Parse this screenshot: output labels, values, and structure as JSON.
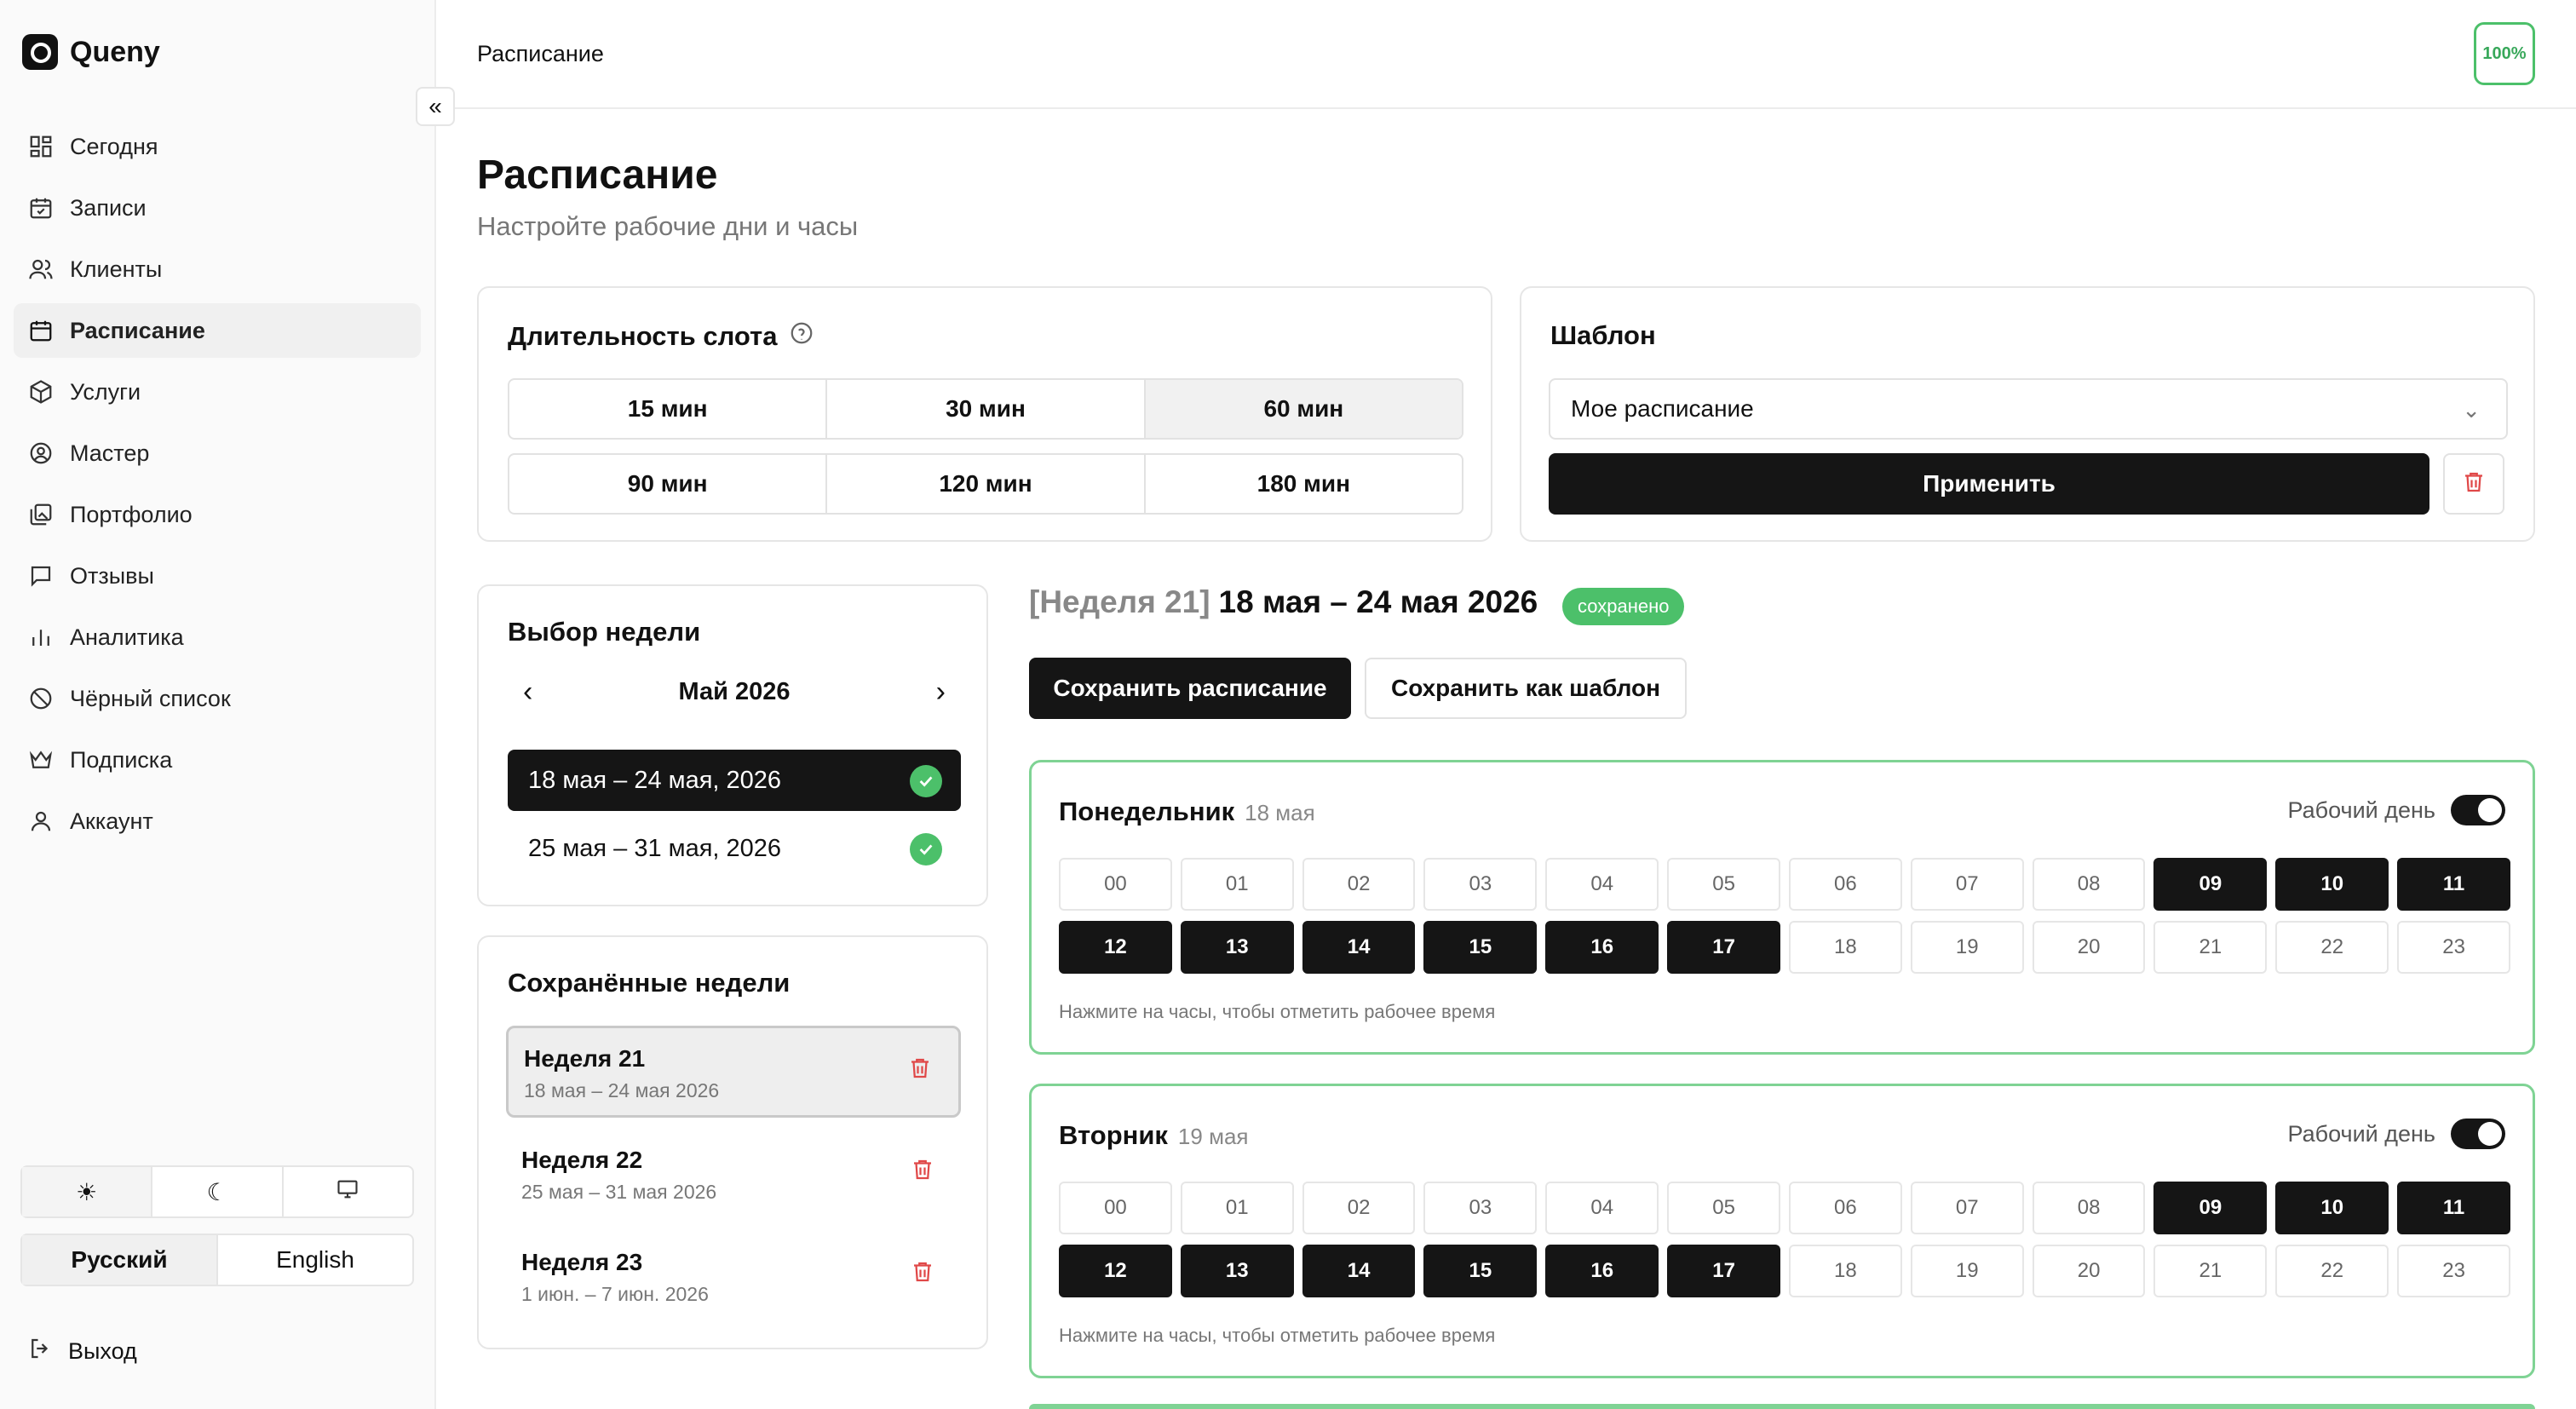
{
  "app": {
    "name": "Queny"
  },
  "sidebar": {
    "items": [
      {
        "label": "Сегодня",
        "icon": "dashboard-icon"
      },
      {
        "label": "Записи",
        "icon": "calendar-check-icon"
      },
      {
        "label": "Клиенты",
        "icon": "users-icon"
      },
      {
        "label": "Расписание",
        "icon": "calendar-icon"
      },
      {
        "label": "Услуги",
        "icon": "package-icon"
      },
      {
        "label": "Мастер",
        "icon": "user-circle-icon"
      },
      {
        "label": "Портфолио",
        "icon": "images-icon"
      },
      {
        "label": "Отзывы",
        "icon": "message-icon"
      },
      {
        "label": "Аналитика",
        "icon": "bar-chart-icon"
      },
      {
        "label": "Чёрный список",
        "icon": "ban-icon"
      },
      {
        "label": "Подписка",
        "icon": "crown-icon"
      },
      {
        "label": "Аккаунт",
        "icon": "user-icon"
      }
    ],
    "active_index": 3,
    "languages": [
      "Русский",
      "English"
    ],
    "active_language": "Русский",
    "logout": "Выход"
  },
  "topbar": {
    "title": "Расписание",
    "progress": "100%"
  },
  "page": {
    "title": "Расписание",
    "subtitle": "Настройте рабочие дни и часы"
  },
  "slot": {
    "title": "Длительность слота",
    "options": [
      "15 мин",
      "30 мин",
      "60 мин",
      "90 мин",
      "120 мин",
      "180 мин"
    ],
    "selected": "60 мин"
  },
  "template": {
    "title": "Шаблон",
    "selected": "Мое расписание",
    "apply_label": "Применить"
  },
  "week_picker": {
    "title": "Выбор недели",
    "month": "Май 2026",
    "weeks": [
      {
        "label": "18 мая – 24 мая, 2026",
        "active": true
      },
      {
        "label": "25 мая – 31 мая, 2026",
        "active": false
      }
    ]
  },
  "saved_weeks": {
    "title": "Сохранённые недели",
    "items": [
      {
        "title": "Неделя 21",
        "range": "18 мая – 24 мая 2026",
        "active": true
      },
      {
        "title": "Неделя 22",
        "range": "25 мая – 31 мая 2026",
        "active": false
      },
      {
        "title": "Неделя 23",
        "range": "1 июн. – 7 июн. 2026",
        "active": false
      }
    ]
  },
  "schedule": {
    "week_label": "[Неделя 21]",
    "range": "18 мая – 24 мая 2026",
    "status": "сохранено",
    "save_label": "Сохранить расписание",
    "save_template_label": "Сохранить как шаблон",
    "workday_label": "Рабочий день",
    "hint": "Нажмите на часы, чтобы отметить рабочее время",
    "days": [
      {
        "name": "Понедельник",
        "date": "18 мая",
        "working_hours": [
          "09",
          "10",
          "11",
          "12",
          "13",
          "14",
          "15",
          "16",
          "17"
        ]
      },
      {
        "name": "Вторник",
        "date": "19 мая",
        "working_hours": [
          "09",
          "10",
          "11",
          "12",
          "13",
          "14",
          "15",
          "16",
          "17"
        ]
      }
    ],
    "hours": [
      "00",
      "01",
      "02",
      "03",
      "04",
      "05",
      "06",
      "07",
      "08",
      "09",
      "10",
      "11",
      "12",
      "13",
      "14",
      "15",
      "16",
      "17",
      "18",
      "19",
      "20",
      "21",
      "22",
      "23"
    ]
  },
  "colors": {
    "accent": "#4cc06a",
    "dark": "#151515",
    "danger": "#e04848"
  }
}
